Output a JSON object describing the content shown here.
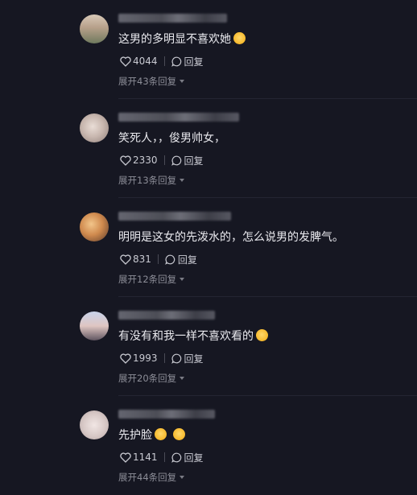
{
  "comments": [
    {
      "text": "这男的多明显不喜欢她",
      "emoji": "laughing-emoji",
      "likes": "4044",
      "reply": "回复",
      "expand": "展开43条回复"
    },
    {
      "text": "笑死人，，俊男帅女，",
      "likes": "2330",
      "reply": "回复",
      "expand": "展开13条回复"
    },
    {
      "text": "明明是这女的先泼水的，怎么说男的发脾气。",
      "likes": "831",
      "reply": "回复",
      "expand": "展开12条回复"
    },
    {
      "text": "有没有和我一样不喜欢看的",
      "emoji": "rolling-laughing-emoji",
      "likes": "1993",
      "reply": "回复",
      "expand": "展开20条回复"
    },
    {
      "text": "先护脸",
      "emoji": "laughing-emoji",
      "likes": "1141",
      "reply": "回复",
      "expand": "展开44条回复"
    }
  ],
  "colors": {
    "background": "#161722",
    "text": "#e9e9ee",
    "muted": "#8c8d97"
  }
}
